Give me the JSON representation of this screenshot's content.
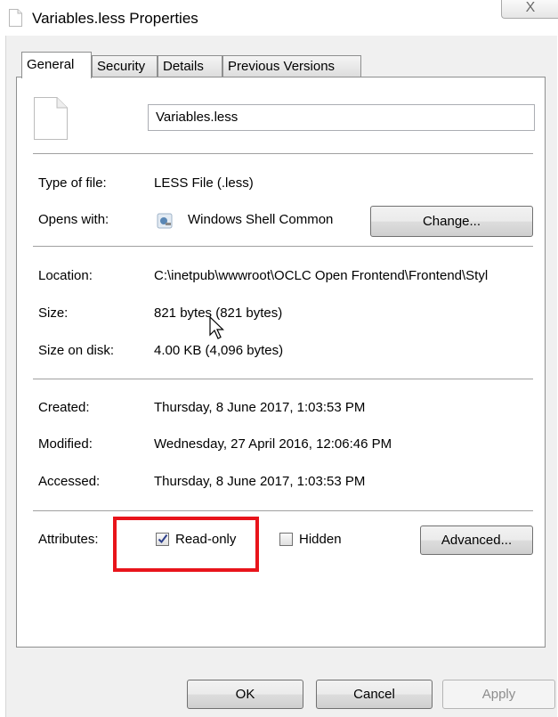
{
  "window": {
    "title": "Variables.less Properties",
    "close_glyph": "X"
  },
  "tabs": [
    {
      "label": "General",
      "active": true
    },
    {
      "label": "Security",
      "active": false
    },
    {
      "label": "Details",
      "active": false
    },
    {
      "label": "Previous Versions",
      "active": false
    }
  ],
  "general": {
    "file_name": "Variables.less",
    "type_label": "Type of file:",
    "type_value": "LESS File (.less)",
    "opens_label": "Opens with:",
    "opens_value": "Windows Shell Common",
    "change_button": "Change...",
    "location_label": "Location:",
    "location_value": "C:\\inetpub\\wwwroot\\OCLC Open Frontend\\Frontend\\Styl",
    "size_label": "Size:",
    "size_value": "821 bytes (821 bytes)",
    "size_on_disk_label": "Size on disk:",
    "size_on_disk_value": "4.00 KB (4,096 bytes)",
    "created_label": "Created:",
    "created_value": "Thursday, 8 June 2017, 1:03:53 PM",
    "modified_label": "Modified:",
    "modified_value": "Wednesday, 27 April 2016, 12:06:46 PM",
    "accessed_label": "Accessed:",
    "accessed_value": "Thursday, 8 June 2017, 1:03:53 PM",
    "attributes_label": "Attributes:",
    "readonly_label": "Read-only",
    "readonly_checked": true,
    "hidden_label": "Hidden",
    "hidden_checked": false,
    "advanced_button": "Advanced..."
  },
  "footer": {
    "ok": "OK",
    "cancel": "Cancel",
    "apply": "Apply"
  },
  "colors": {
    "highlight_box": "#e8141b",
    "dialog_bg": "#f0f0f0",
    "disabled_text": "#8d8d8d"
  }
}
